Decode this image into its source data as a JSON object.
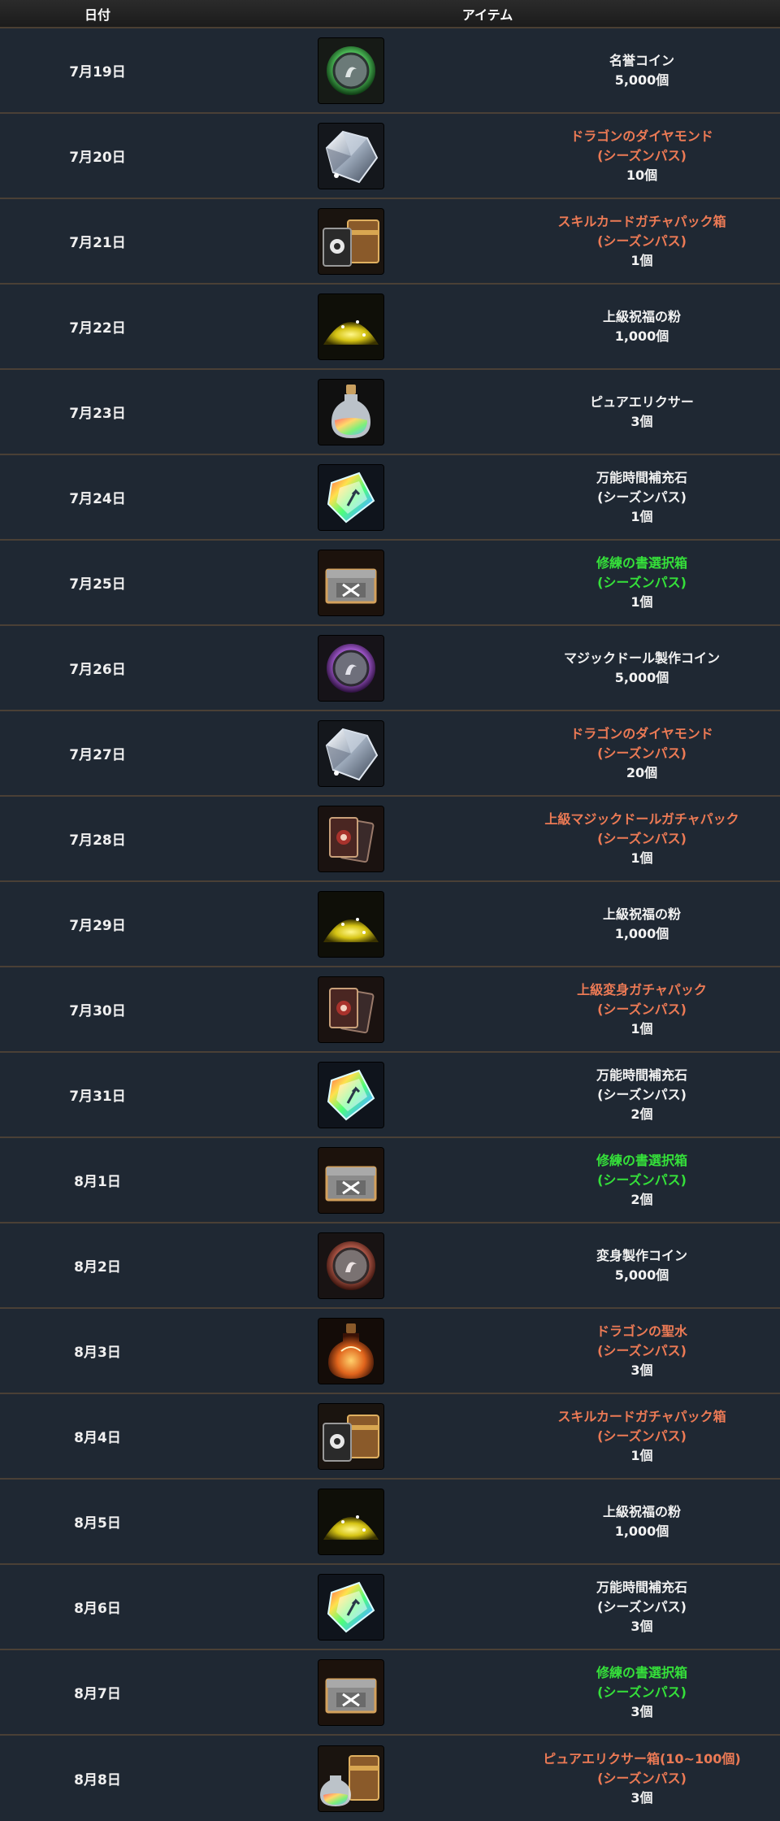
{
  "header": {
    "date_label": "日付",
    "item_label": "アイテム"
  },
  "colors": {
    "orange": "#ec7a55",
    "green": "#35e03a",
    "white": "#f2f2f2"
  },
  "rows": [
    {
      "date": "7月19日",
      "icon": "green-coin-icon",
      "color": "white",
      "name": "名誉コイン",
      "sub": "",
      "qty": "5,000個"
    },
    {
      "date": "7月20日",
      "icon": "diamond-icon",
      "color": "orange",
      "name": "ドラゴンのダイヤモンド",
      "sub": "(シーズンパス)",
      "qty": "10個"
    },
    {
      "date": "7月21日",
      "icon": "skill-card-box-icon",
      "color": "orange",
      "name": "スキルカードガチャパック箱",
      "sub": "(シーズンパス)",
      "qty": "1個"
    },
    {
      "date": "7月22日",
      "icon": "gold-powder-icon",
      "color": "white",
      "name": "上級祝福の粉",
      "sub": "",
      "qty": "1,000個"
    },
    {
      "date": "7月23日",
      "icon": "elixir-icon",
      "color": "white",
      "name": "ピュアエリクサー",
      "sub": "",
      "qty": "3個"
    },
    {
      "date": "7月24日",
      "icon": "rainbow-stone-icon",
      "color": "white",
      "name": "万能時間補充石",
      "sub": "(シーズンパス)",
      "qty": "1個"
    },
    {
      "date": "7月25日",
      "icon": "chest-icon",
      "color": "green",
      "name": "修練の書選択箱",
      "sub": "(シーズンパス)",
      "qty": "1個"
    },
    {
      "date": "7月26日",
      "icon": "purple-coin-icon",
      "color": "white",
      "name": "マジックドール製作コイン",
      "sub": "",
      "qty": "5,000個"
    },
    {
      "date": "7月27日",
      "icon": "diamond-icon",
      "color": "orange",
      "name": "ドラゴンのダイヤモンド",
      "sub": "(シーズンパス)",
      "qty": "20個"
    },
    {
      "date": "7月28日",
      "icon": "card-pack-icon",
      "color": "orange",
      "name": "上級マジックドールガチャパック",
      "sub": "(シーズンパス)",
      "qty": "1個"
    },
    {
      "date": "7月29日",
      "icon": "gold-powder-icon",
      "color": "white",
      "name": "上級祝福の粉",
      "sub": "",
      "qty": "1,000個"
    },
    {
      "date": "7月30日",
      "icon": "card-pack-icon",
      "color": "orange",
      "name": "上級変身ガチャパック",
      "sub": "(シーズンパス)",
      "qty": "1個"
    },
    {
      "date": "7月31日",
      "icon": "rainbow-stone-icon",
      "color": "white",
      "name": "万能時間補充石",
      "sub": "(シーズンパス)",
      "qty": "2個"
    },
    {
      "date": "8月1日",
      "icon": "chest-icon",
      "color": "green",
      "name": "修練の書選択箱",
      "sub": "(シーズンパス)",
      "qty": "2個"
    },
    {
      "date": "8月2日",
      "icon": "red-coin-icon",
      "color": "white",
      "name": "変身製作コイン",
      "sub": "",
      "qty": "5,000個"
    },
    {
      "date": "8月3日",
      "icon": "holy-water-icon",
      "color": "orange",
      "name": "ドラゴンの聖水",
      "sub": "(シーズンパス)",
      "qty": "3個"
    },
    {
      "date": "8月4日",
      "icon": "skill-card-box-icon",
      "color": "orange",
      "name": "スキルカードガチャパック箱",
      "sub": "(シーズンパス)",
      "qty": "1個"
    },
    {
      "date": "8月5日",
      "icon": "gold-powder-icon",
      "color": "white",
      "name": "上級祝福の粉",
      "sub": "",
      "qty": "1,000個"
    },
    {
      "date": "8月6日",
      "icon": "rainbow-stone-icon",
      "color": "white",
      "name": "万能時間補充石",
      "sub": "(シーズンパス)",
      "qty": "3個"
    },
    {
      "date": "8月7日",
      "icon": "chest-icon",
      "color": "green",
      "name": "修練の書選択箱",
      "sub": "(シーズンパス)",
      "qty": "3個"
    },
    {
      "date": "8月8日",
      "icon": "elixir-box-icon",
      "color": "orange",
      "name": "ピュアエリクサー箱(10~100個)",
      "sub": "(シーズンパス)",
      "qty": "3個"
    }
  ]
}
